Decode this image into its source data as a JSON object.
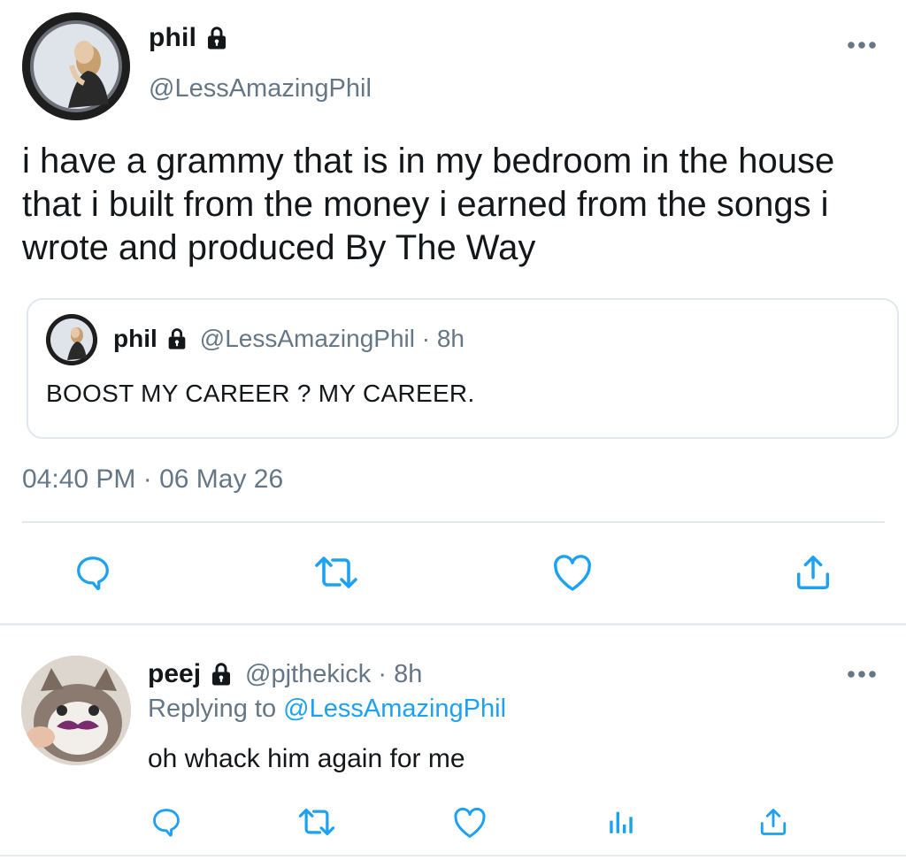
{
  "tweet": {
    "display_name": "phil",
    "handle": "@LessAmazingPhil",
    "text": "i have a grammy that is in my bedroom in the house that i built from the money i earned from the songs i wrote and produced By The Way",
    "quoted": {
      "display_name": "phil",
      "handle_time": "@LessAmazingPhil · 8h",
      "text": "BOOST MY CAREER ? MY CAREER."
    },
    "timestamp": "04:40 PM · 06 May 26"
  },
  "reply": {
    "display_name": "peej",
    "handle_time": "@pjthekick · 8h",
    "replying_prefix": "Replying to ",
    "replying_handle": "@LessAmazingPhil",
    "text": "oh whack him again for me"
  },
  "colors": {
    "link": "#1da1f2",
    "icon": "#1da1f2",
    "muted": "#657786",
    "text": "#14171a",
    "divider": "#e1e8ed"
  },
  "icons": [
    "lock-icon",
    "more-icon",
    "reply-icon",
    "retweet-icon",
    "like-icon",
    "share-icon",
    "analytics-icon"
  ]
}
